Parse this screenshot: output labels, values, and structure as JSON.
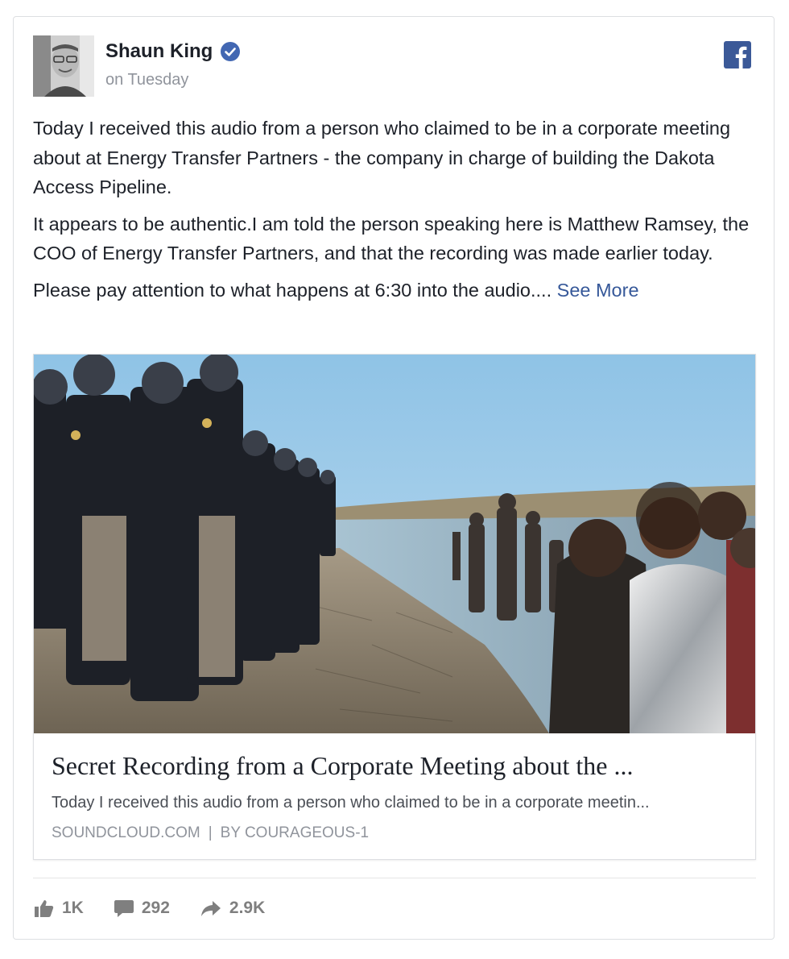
{
  "post": {
    "author": "Shaun King",
    "timestamp": "on Tuesday",
    "paragraphs": [
      "Today I received this audio from a person who claimed to be in a corporate meeting about at Energy Transfer Partners - the company in charge of building the Dakota Access Pipeline.",
      "It appears to be authentic.I am told the person speaking here is Matthew Ramsey, the COO of Energy Transfer Partners, and that the recording was made earlier today."
    ],
    "last_line": "Please pay attention to what happens at 6:30 into the audio....",
    "see_more": "See More"
  },
  "link": {
    "title": "Secret Recording from a Corporate Meeting about the ...",
    "description": "Today I received this audio from a person who claimed to be in a corporate meetin...",
    "domain": "SOUNDCLOUD.COM",
    "separator": "|",
    "byline": "BY COURAGEOUS-1",
    "image_alt": "police line facing protesters at river"
  },
  "stats": {
    "likes": "1K",
    "comments": "292",
    "shares": "2.9K"
  },
  "colors": {
    "facebook_blue": "#3b5998",
    "verified_blue": "#4267b2",
    "link_blue": "#365899"
  }
}
